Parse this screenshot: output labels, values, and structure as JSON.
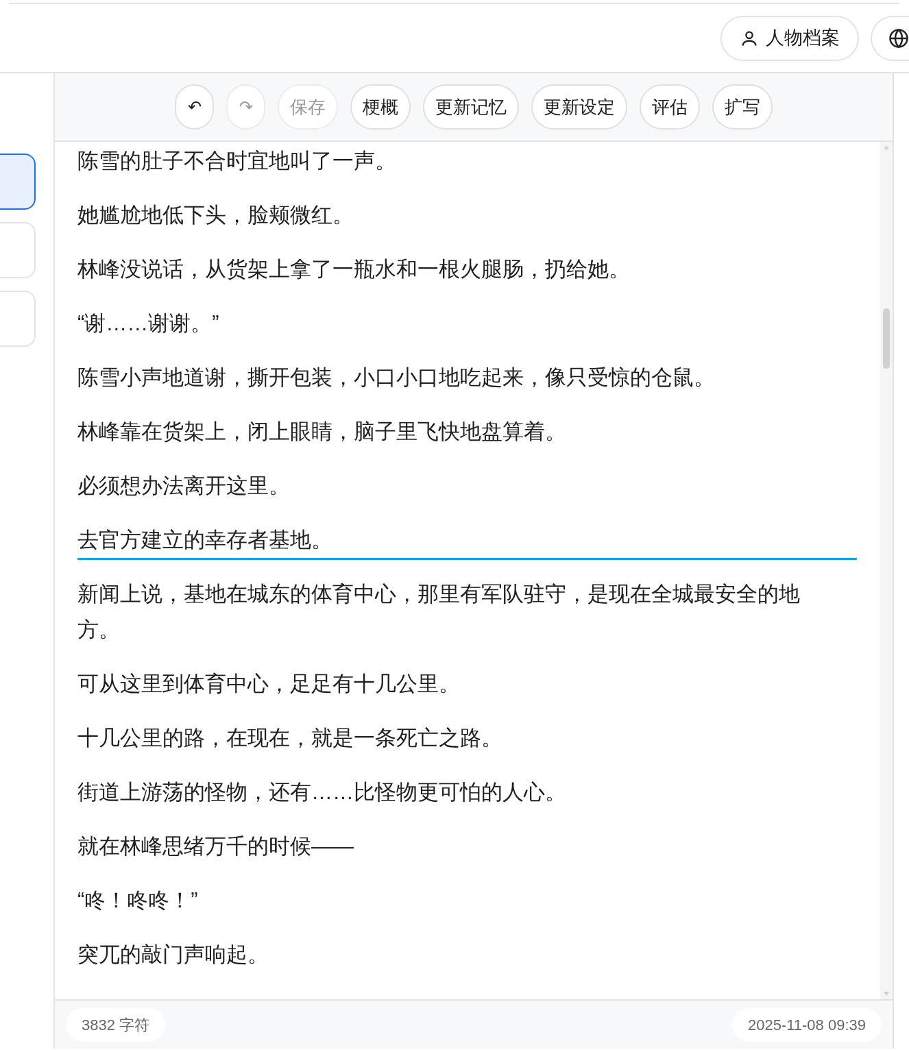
{
  "header": {
    "buttons": [
      {
        "kind": "person",
        "label": "人物档案"
      },
      {
        "kind": "globe"
      }
    ]
  },
  "sidebar": {
    "items": [
      {
        "selected": true
      },
      {
        "selected": false
      },
      {
        "selected": false
      }
    ]
  },
  "toolbar": {
    "buttons": [
      {
        "kind": "undo",
        "label": "↶",
        "disabled": false
      },
      {
        "kind": "redo",
        "label": "↷",
        "disabled": true
      },
      {
        "kind": "text",
        "label": "保存",
        "disabled": true
      },
      {
        "kind": "text",
        "label": "梗概",
        "disabled": false
      },
      {
        "kind": "text",
        "label": "更新记忆",
        "disabled": false
      },
      {
        "kind": "text",
        "label": "更新设定",
        "disabled": false
      },
      {
        "kind": "text",
        "label": "评估",
        "disabled": false
      },
      {
        "kind": "text",
        "label": "扩写",
        "disabled": false
      }
    ]
  },
  "editor": {
    "paragraphs": [
      {
        "text": "陈雪的肚子不合时宜地叫了一声。",
        "selected": false
      },
      {
        "text": "她尴尬地低下头，脸颊微红。",
        "selected": false
      },
      {
        "text": "林峰没说话，从货架上拿了一瓶水和一根火腿肠，扔给她。",
        "selected": false
      },
      {
        "text": "“谢……谢谢。”",
        "selected": false
      },
      {
        "text": "陈雪小声地道谢，撕开包装，小口小口地吃起来，像只受惊的仓鼠。",
        "selected": false
      },
      {
        "text": "林峰靠在货架上，闭上眼睛，脑子里飞快地盘算着。",
        "selected": false
      },
      {
        "text": "必须想办法离开这里。",
        "selected": false
      },
      {
        "text": "去官方建立的幸存者基地。",
        "selected": true
      },
      {
        "text": "新闻上说，基地在城东的体育中心，那里有军队驻守，是现在全城最安全的地方。",
        "selected": false
      },
      {
        "text": "可从这里到体育中心，足足有十几公里。",
        "selected": false
      },
      {
        "text": "十几公里的路，在现在，就是一条死亡之路。",
        "selected": false
      },
      {
        "text": "街道上游荡的怪物，还有……比怪物更可怕的人心。",
        "selected": false
      },
      {
        "text": "就在林峰思绪万千的时候——",
        "selected": false
      },
      {
        "text": "“咚！咚咚！”",
        "selected": false
      },
      {
        "text": "突兀的敲门声响起。",
        "selected": false
      }
    ]
  },
  "status_bar": {
    "char_count": "3832 字符",
    "timestamp": "2025-11-08 09:39"
  }
}
